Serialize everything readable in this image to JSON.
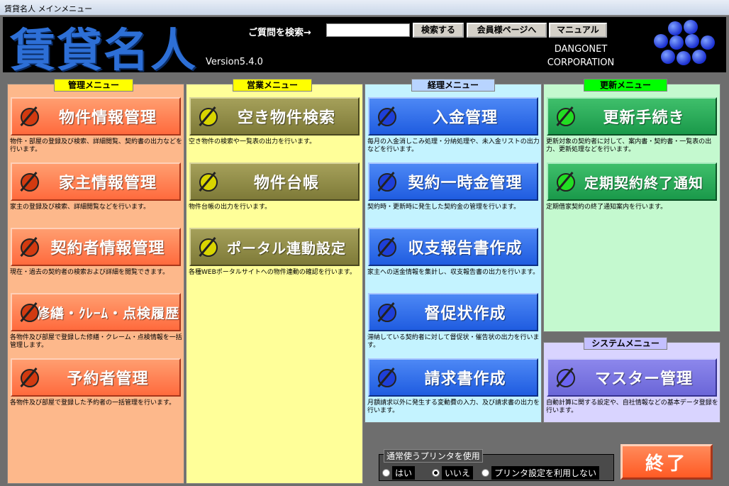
{
  "window": {
    "title": "賃貸名人 メインメニュー"
  },
  "header": {
    "logo": "賃貸名人",
    "version": "Version5.4.0",
    "search_label": "ご質問を検索→",
    "search_value": "",
    "search_button": "検索する",
    "member_button": "会員様ページへ",
    "manual_button": "マニュアル",
    "corp_line1": "DANGONET",
    "corp_line2": "CORPORATION"
  },
  "panels": {
    "kanri": {
      "title": "管理メニュー",
      "items": [
        {
          "label": "物件情報管理",
          "desc": "物件・部屋の登録及び検索、詳細閲覧、契約書の出力などを行います。"
        },
        {
          "label": "家主情報管理",
          "desc": "家主の登録及び検索、詳細閲覧などを行います。"
        },
        {
          "label": "契約者情報管理",
          "desc": "現在・過去の契約者の検索および詳細を閲覧できます。"
        },
        {
          "label": "修繕・ｸﾚｰﾑ・点検履歴",
          "desc": "各物件及び部屋で登録した修繕・クレーム・点検情報を一括管理します。"
        },
        {
          "label": "予約者管理",
          "desc": "各物件及び部屋で登録した予約者の一括管理を行います。"
        }
      ]
    },
    "eigyo": {
      "title": "営業メニュー",
      "items": [
        {
          "label": "空き物件検索",
          "desc": "空き物件の検索や一覧表の出力を行います。"
        },
        {
          "label": "物件台帳",
          "desc": "物件台帳の出力を行います。"
        },
        {
          "label": "ポータル連動設定",
          "desc": "各種WEBポータルサイトへの物件連動の確認を行います。"
        }
      ]
    },
    "keiri": {
      "title": "経理メニュー",
      "items": [
        {
          "label": "入金管理",
          "desc": "毎月の入金消しこみ処理・分納処理や、未入金リストの出力などを行います。"
        },
        {
          "label": "契約一時金管理",
          "desc": "契約時・更新時に発生した契約金の管理を行います。"
        },
        {
          "label": "収支報告書作成",
          "desc": "家主への送金情報を集計し、収支報告書の出力を行います。"
        },
        {
          "label": "督促状作成",
          "desc": "滞納している契約者に対して督促状・催告状の出力を行います。"
        },
        {
          "label": "請求書作成",
          "desc": "月額請求以外に発生する変動費の入力、及び請求書の出力を行います。"
        }
      ]
    },
    "koshin": {
      "title": "更新メニュー",
      "items": [
        {
          "label": "更新手続き",
          "desc": "更新対象の契約者に対して、案内書・契約書・一覧表の出力、更新処理などを行います。"
        },
        {
          "label": "定期契約終了通知",
          "desc": "定期借家契約の終了通知案内を行います。"
        }
      ]
    },
    "system": {
      "title": "システムメニュー",
      "items": [
        {
          "label": "マスター管理",
          "desc": "自動計算に関する設定や、自社情報などの基本データ登録を行います。"
        }
      ]
    }
  },
  "printer": {
    "title": "通常使うプリンタを使用",
    "options": [
      "はい",
      "いいえ",
      "プリンタ設定を利用しない"
    ],
    "selected": "いいえ"
  },
  "exit_button": "終了"
}
